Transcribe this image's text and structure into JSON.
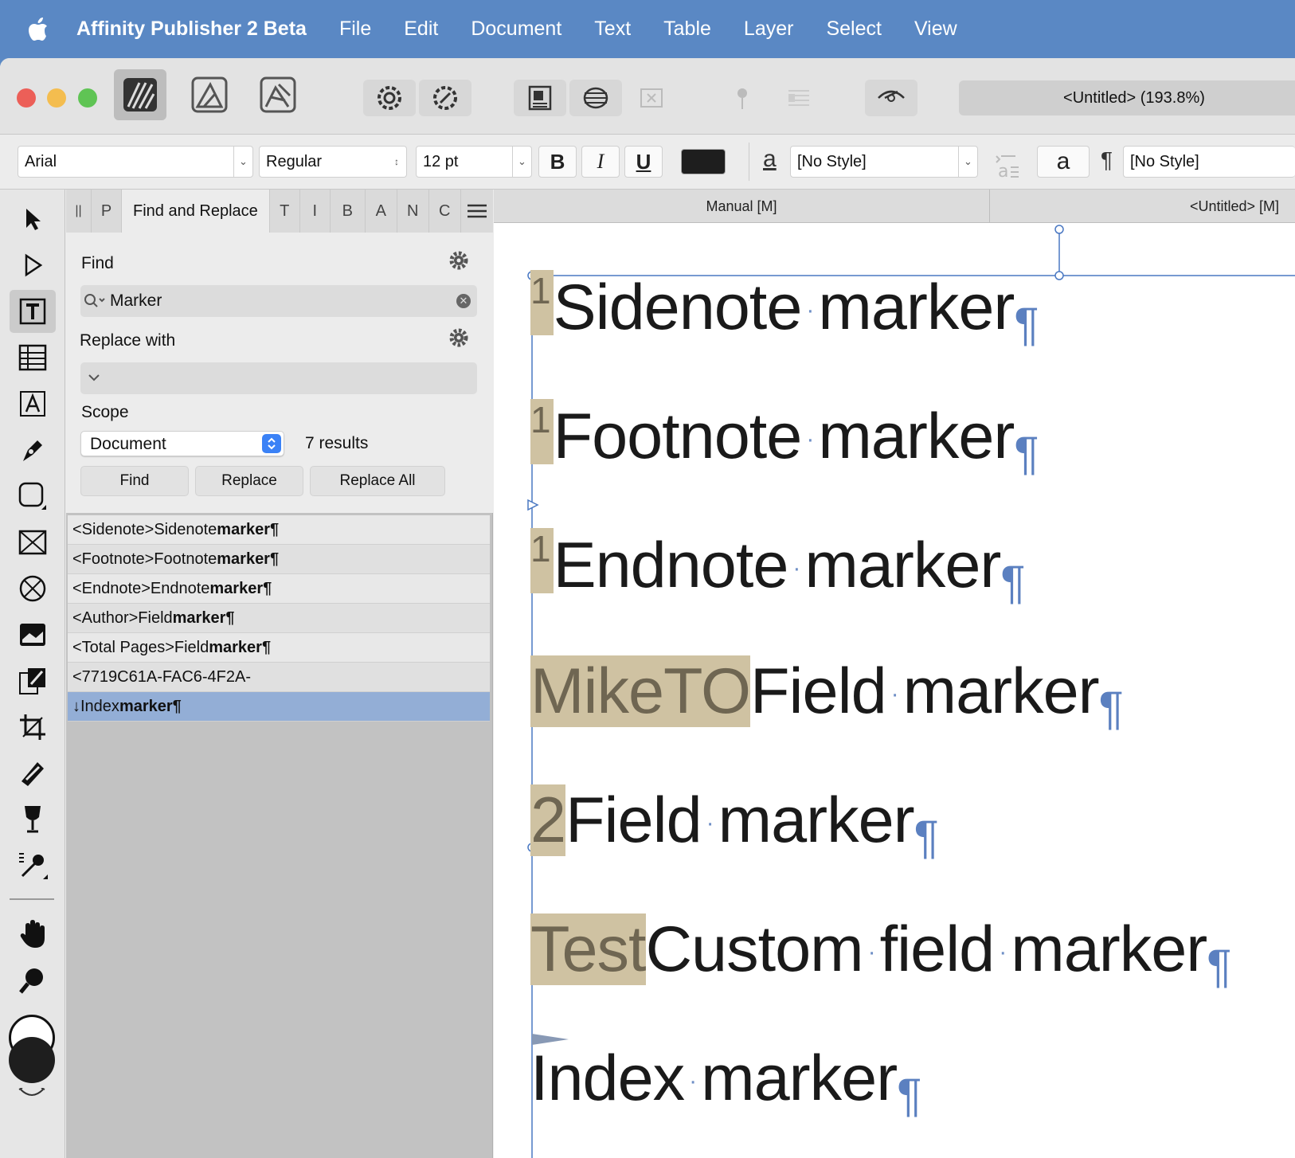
{
  "menubar": {
    "app_name": "Affinity Publisher 2 Beta",
    "items": [
      "File",
      "Edit",
      "Document",
      "Text",
      "Table",
      "Layer",
      "Select",
      "View"
    ]
  },
  "toolbar": {
    "document_title": "<Untitled> (193.8%)"
  },
  "context": {
    "font_family": "Arial",
    "font_style": "Regular",
    "font_size": "12 pt",
    "bold": "B",
    "italic": "I",
    "underline": "U",
    "char_style_glyph": "a",
    "char_style": "[No Style]",
    "para_glyph": "a",
    "para_mark": "¶",
    "para_style": "[No Style]",
    "text_color": "#1e1e1e"
  },
  "panel": {
    "tabs": [
      "||",
      "P",
      "Find and Replace",
      "T",
      "I",
      "B",
      "A",
      "N",
      "C"
    ],
    "find_label": "Find",
    "find_value": "Marker",
    "replace_label": "Replace with",
    "scope_label": "Scope",
    "scope_value": "Document",
    "results_count": "7 results",
    "buttons": {
      "find": "Find",
      "replace": "Replace",
      "replace_all": "Replace All"
    },
    "results": [
      {
        "prefix": "<Sidenote>Sidenote ",
        "bold": "marker¶"
      },
      {
        "prefix": "<Footnote>Footnote ",
        "bold": "marker¶"
      },
      {
        "prefix": "<Endnote>Endnote ",
        "bold": "marker¶"
      },
      {
        "prefix": "<Author>Field ",
        "bold": "marker¶"
      },
      {
        "prefix": "<Total Pages>Field ",
        "bold": "marker¶"
      },
      {
        "prefix": "<7719C61A-FAC6-4F2A-",
        "bold": ""
      },
      {
        "prefix": "↓Index ",
        "bold": "marker¶"
      }
    ]
  },
  "doc_tabs": [
    "Manual [M]",
    "<Untitled> [M]"
  ],
  "document": {
    "lines": [
      {
        "marker": "1",
        "marker_type": "sup",
        "text": [
          "Sidenote",
          "marker"
        ]
      },
      {
        "marker": "1",
        "marker_type": "sup",
        "text": [
          "Footnote",
          "marker"
        ]
      },
      {
        "marker": "1",
        "marker_type": "sup",
        "text": [
          "Endnote",
          "marker"
        ]
      },
      {
        "marker": "MikeTO",
        "marker_type": "field",
        "text": [
          "Field",
          "marker"
        ]
      },
      {
        "marker": "2",
        "marker_type": "field",
        "text": [
          "Field",
          "marker"
        ]
      },
      {
        "marker": "Test",
        "marker_type": "field",
        "text": [
          "Custom",
          "field",
          "marker"
        ]
      },
      {
        "marker": "",
        "marker_type": "index",
        "text": [
          "Index",
          "marker"
        ]
      }
    ],
    "space_glyph": "·",
    "pilcrow": "¶"
  }
}
